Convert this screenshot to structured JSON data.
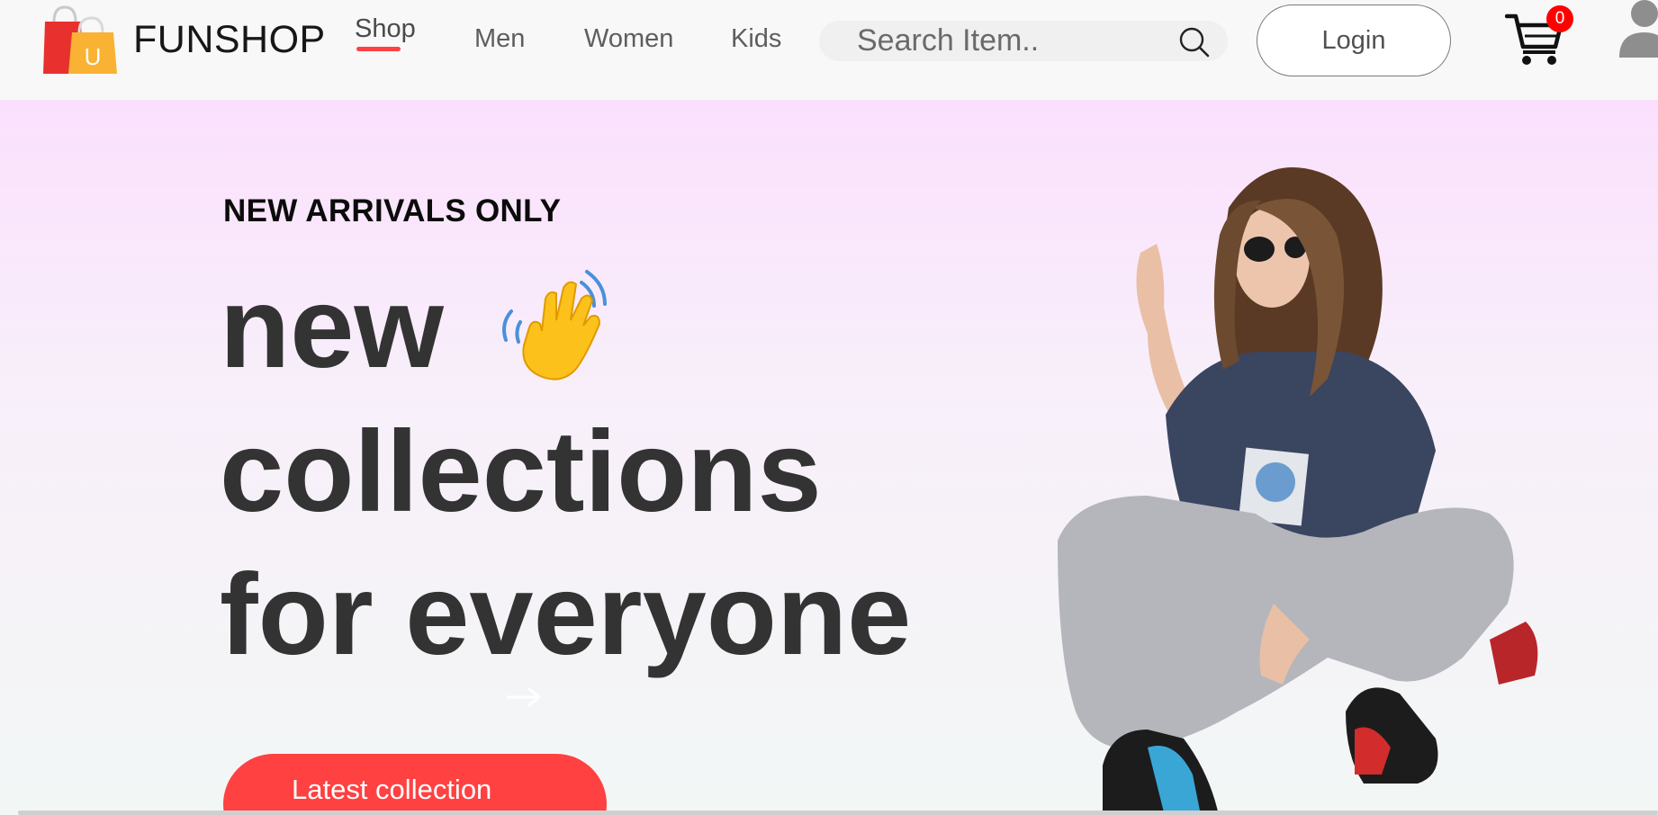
{
  "navbar": {
    "logo_icon": "shopping-bags-icon",
    "logo_letter": "U",
    "brand": "FUNSHOP",
    "links": [
      {
        "label": "Shop",
        "active": true
      },
      {
        "label": "Men",
        "active": false
      },
      {
        "label": "Women",
        "active": false
      },
      {
        "label": "Kids",
        "active": false
      }
    ],
    "search": {
      "placeholder": "Search Item..",
      "icon": "search-icon"
    },
    "login_label": "Login",
    "cart": {
      "icon": "cart-icon",
      "count": "0"
    },
    "avatar_icon": "user-icon"
  },
  "hero": {
    "eyebrow": "NEW ARRIVALS ONLY",
    "headline": [
      "new",
      "collections",
      "for everyone"
    ],
    "wave_icon": "waving-hand-icon",
    "cta_label": "Latest collection",
    "cta_icon": "arrow-right-icon",
    "image": "model-photo"
  },
  "colors": {
    "accent": "#ff4141",
    "badge": "#ff0000",
    "headline": "#333333",
    "hero_gradient_top": "#fbe0fd",
    "hero_gradient_bottom": "#f2f7f5"
  }
}
